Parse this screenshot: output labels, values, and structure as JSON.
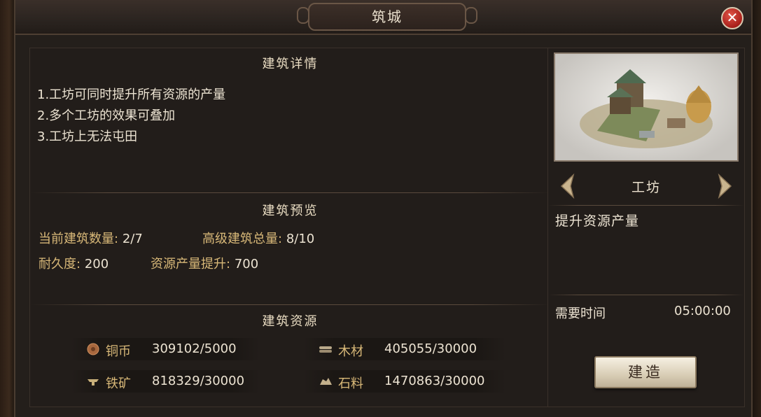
{
  "window": {
    "title": "筑城",
    "close_symbol": "✕"
  },
  "details": {
    "title": "建筑详情",
    "lines": [
      "1.工坊可同时提升所有资源的产量",
      "2.多个工坊的效果可叠加",
      "3.工坊上无法屯田"
    ]
  },
  "preview_section": {
    "title": "建筑预览",
    "current_count_label": "当前建筑数量:",
    "current_count_value": "2/7",
    "advanced_total_label": "高级建筑总量:",
    "advanced_total_value": "8/10",
    "durability_label": "耐久度:",
    "durability_value": "200",
    "production_boost_label": "资源产量提升:",
    "production_boost_value": "700"
  },
  "resources": {
    "title": "建筑资源",
    "items": [
      {
        "icon": "copper-coin-icon",
        "name": "铜币",
        "value": "309102/5000"
      },
      {
        "icon": "wood-icon",
        "name": "木材",
        "value": "405055/30000"
      },
      {
        "icon": "iron-ore-icon",
        "name": "铁矿",
        "value": "818329/30000"
      },
      {
        "icon": "stone-icon",
        "name": "石料",
        "value": "1470863/30000"
      }
    ]
  },
  "building": {
    "name": "工坊",
    "description": "提升资源产量",
    "time_label": "需要时间",
    "time_value": "05:00:00",
    "build_label": "建造"
  },
  "colors": {
    "accent_gold": "#d8b878",
    "close_red": "#c0392b",
    "panel_bg": "#221d1a"
  }
}
